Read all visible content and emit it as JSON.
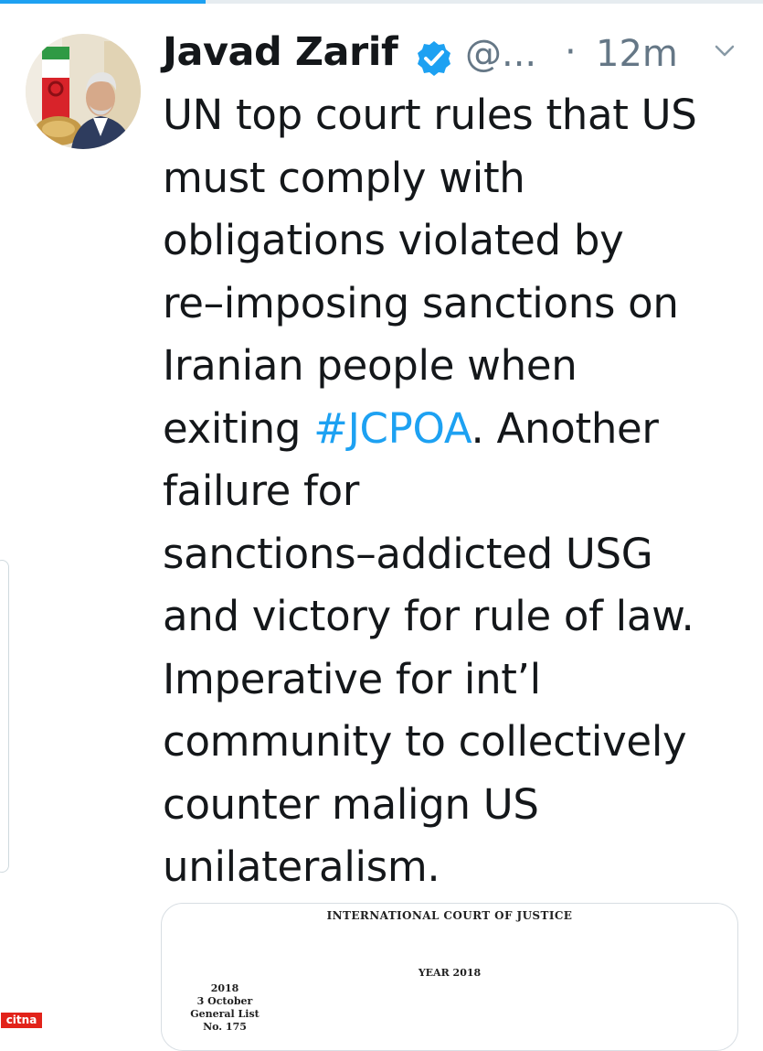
{
  "progress": {
    "fraction": 0.27
  },
  "tweet": {
    "author_name": "Javad Zarif",
    "handle": "@...",
    "separator": "·",
    "timestamp": "12m",
    "text_lines": [
      [
        {
          "t": "UN top court rules that US"
        }
      ],
      [
        {
          "t": "must comply with"
        }
      ],
      [
        {
          "t": "obligations violated by"
        }
      ],
      [
        {
          "t": "re–imposing sanctions on"
        }
      ],
      [
        {
          "t": "Iranian people when"
        }
      ],
      [
        {
          "t": "exiting "
        },
        {
          "t": "#JCPOA",
          "hashtag": true
        },
        {
          "t": ". Another"
        }
      ],
      [
        {
          "t": "failure for"
        }
      ],
      [
        {
          "t": "sanctions–addicted USG"
        }
      ],
      [
        {
          "t": "and victory for rule of law."
        }
      ],
      [
        {
          "t": "Imperative for int’l"
        }
      ],
      [
        {
          "t": "community to collectively"
        }
      ],
      [
        {
          "t": "counter malign US"
        }
      ],
      [
        {
          "t": "unilateralism."
        }
      ]
    ]
  },
  "media": {
    "doc_title": "INTERNATIONAL COURT OF JUSTICE",
    "doc_year": "YEAR 2018",
    "side_lines": [
      "2018",
      "3 October",
      "General List",
      "No. 175"
    ]
  },
  "icons": {
    "verified": "verified-badge-icon",
    "more": "chevron-down-icon"
  },
  "colors": {
    "accent": "#1da1f2",
    "text": "#14171a",
    "muted": "#657786",
    "watermark_bg": "#e2231a"
  },
  "watermark": {
    "text": "citna"
  }
}
